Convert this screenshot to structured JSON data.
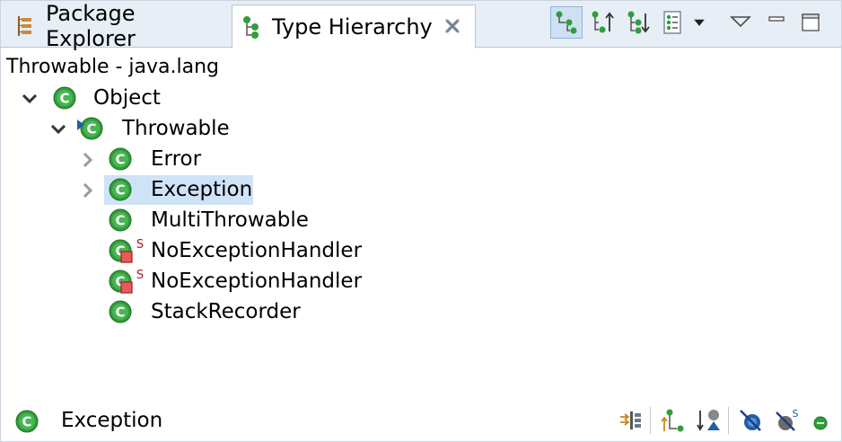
{
  "tabs": [
    {
      "label": "Package Explorer",
      "icon": "package-explorer-icon"
    },
    {
      "label": "Type Hierarchy",
      "icon": "type-hierarchy-icon",
      "active": true
    }
  ],
  "toolbar": {
    "buttons": [
      {
        "name": "show-type-hierarchy",
        "active": true
      },
      {
        "name": "show-supertype-hierarchy"
      },
      {
        "name": "show-subtype-hierarchy"
      },
      {
        "name": "previous-hierarchy-inputs"
      },
      {
        "name": "view-menu"
      },
      {
        "name": "minimize"
      },
      {
        "name": "maximize"
      }
    ]
  },
  "scope": {
    "label": "Throwable - java.lang"
  },
  "tree": {
    "items": [
      {
        "label": "Object",
        "depth": 0,
        "expanded": true
      },
      {
        "label": "Throwable",
        "depth": 1,
        "expanded": true,
        "focus": true
      },
      {
        "label": "Error",
        "depth": 2,
        "expandable": true
      },
      {
        "label": "Exception",
        "depth": 2,
        "expandable": true,
        "selected": true
      },
      {
        "label": "MultiThrowable",
        "depth": 2
      },
      {
        "label": "NoExceptionHandler",
        "depth": 2,
        "static": true,
        "marker": "S"
      },
      {
        "label": "NoExceptionHandler",
        "depth": 2,
        "static": true,
        "marker": "S"
      },
      {
        "label": "StackRecorder",
        "depth": 2
      }
    ]
  },
  "status": {
    "label": "Exception"
  },
  "colors": {
    "class_icon_green": "#2f9e3a",
    "selection": "#cfe3f7",
    "tabbar_bg": "#e8eef6",
    "static_red": "#d23a3a",
    "accent_blue": "#1f5fa8"
  }
}
